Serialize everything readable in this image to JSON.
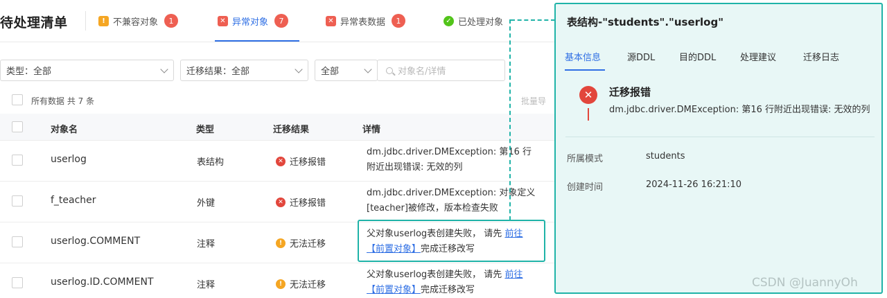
{
  "page": {
    "title": "待处理清单"
  },
  "tabs": [
    {
      "label": "不兼容对象",
      "count": "1",
      "icon": "warning-icon",
      "color": "#f5a623"
    },
    {
      "label": "异常对象",
      "count": "7",
      "icon": "error-doc-icon",
      "color": "#ee5f52"
    },
    {
      "label": "异常表数据",
      "count": "1",
      "icon": "error-table-icon",
      "color": "#ee5f52"
    },
    {
      "label": "已处理对象",
      "icon": "check-circle-icon",
      "color": "#52c41a"
    }
  ],
  "filters": {
    "type": "类型：全部",
    "result": "迁移结果：全部",
    "scope": "全部",
    "search_placeholder": "对象名/详情"
  },
  "summary": {
    "total": "所有数据 共 7 条",
    "batch": "批量导"
  },
  "table": {
    "headers": [
      "对象名",
      "类型",
      "迁移结果",
      "详情"
    ],
    "rows": [
      {
        "name": "userlog",
        "type": "表结构",
        "result": "迁移报错",
        "result_kind": "error",
        "detail_l1": "dm.jdbc.driver.DMException: 第16 行",
        "detail_l2": "附近出现错误: 无效的列"
      },
      {
        "name": "f_teacher",
        "type": "外键",
        "result": "迁移报错",
        "result_kind": "error",
        "detail_l1": "dm.jdbc.driver.DMException: 对象定义",
        "detail_l2": "[teacher]被修改，版本检查失败"
      },
      {
        "name": "userlog.COMMENT",
        "type": "注释",
        "result": "无法迁移",
        "result_kind": "warn",
        "detail_l1": "父对象userlog表创建失败， 请先 ",
        "detail_link1": "前往",
        "detail_link2": "【前置对象】",
        "detail_l2_tail": "完成迁移改写"
      },
      {
        "name": "userlog.ID.COMMENT",
        "type": "注释",
        "result": "无法迁移",
        "result_kind": "warn",
        "detail_l1": "父对象userlog表创建失败， 请先 ",
        "detail_link1": "前往",
        "detail_link2": "【前置对象】",
        "detail_l2_tail": "完成迁移改写"
      }
    ]
  },
  "drawer": {
    "title": "表结构-\"students\".\"userlog\"",
    "tabs": [
      "基本信息",
      "源DDL",
      "目的DDL",
      "处理建议",
      "迁移日志"
    ],
    "error_title": "迁移报错",
    "error_message": "dm.jdbc.driver.DMException: 第16 行附近出现错误: 无效的列",
    "fields": [
      {
        "label": "所属模式",
        "value": "students"
      },
      {
        "label": "创建时间",
        "value": "2024-11-26 16:21:10"
      }
    ]
  },
  "watermark": "CSDN @JuannyOh",
  "colors": {
    "accent": "#2f6fe4",
    "highlight": "#1fb3a8",
    "error": "#e2463c",
    "warning": "#f5a623"
  }
}
